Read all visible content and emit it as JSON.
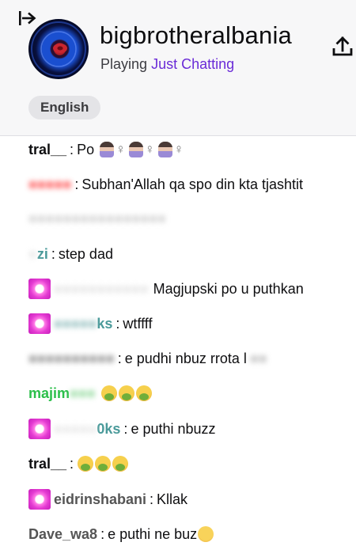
{
  "header": {
    "channel_name": "bigbrotheralbania",
    "playing_prefix": "Playing",
    "game": "Just Chatting",
    "language": "English"
  },
  "icons": {
    "collapse": "collapse-right-icon",
    "share": "share-upload-icon",
    "badge": "subscriber-badge-icon",
    "sick_emoji": "nauseated-face-emoji",
    "person_emoji": "woman-gesturing-emoji",
    "meh_emoji": "confused-face-emoji"
  },
  "colors": {
    "game_link": "#6a2bd7",
    "user_red": "#ff4d4d",
    "user_teal": "#4a9a9a",
    "user_green": "#2bbf4a",
    "user_dark": "#0e0e10",
    "badge_pink": "#e43bd2"
  },
  "chat": [
    {
      "user": "tral__",
      "text": "Po"
    },
    {
      "user": "",
      "text": "Subhan'Allah qa spo din kta tjashtit"
    },
    {
      "user": "",
      "text": ""
    },
    {
      "user": "zi",
      "text": "step dad"
    },
    {
      "user": "",
      "text": "Magjupski po u puthkan"
    },
    {
      "user": "ks",
      "text": "wtffff"
    },
    {
      "user": "",
      "text": "e pudhi nbuz rrota l"
    },
    {
      "user": "majim",
      "text": ""
    },
    {
      "user": "0ks",
      "text": "e puthi nbuzz"
    },
    {
      "user": "tral__",
      "text": ""
    },
    {
      "user": "eidrinshabani",
      "text": "Kllak"
    },
    {
      "user": "Dave_wa8",
      "text": "e puthi ne buz"
    }
  ]
}
